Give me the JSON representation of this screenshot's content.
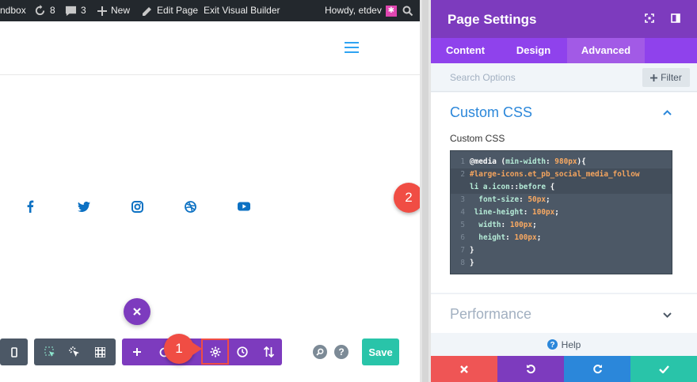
{
  "adminbar": {
    "site_label": "ndbox",
    "updates_count": "8",
    "comments_count": "3",
    "new_label": "New",
    "edit_label": "Edit Page",
    "exit_label": "Exit Visual Builder",
    "greeting": "Howdy, etdev"
  },
  "social_icons": [
    "facebook-icon",
    "twitter-icon",
    "instagram-icon",
    "dribbble-icon",
    "youtube-icon"
  ],
  "builder": {
    "save_label": "Save",
    "markers": {
      "one": "1",
      "two": "2"
    }
  },
  "panel": {
    "title": "Page Settings",
    "tabs": [
      {
        "label": "Content",
        "active": false
      },
      {
        "label": "Design",
        "active": false
      },
      {
        "label": "Advanced",
        "active": true
      }
    ],
    "search_placeholder": "Search Options",
    "filter_label": "Filter",
    "section_title": "Custom CSS",
    "field_label": "Custom CSS",
    "code_lines": [
      {
        "n": "1",
        "text": "@media (min-width: 980px){"
      },
      {
        "n": "2",
        "text": "#large-icons.et_pb_social_media_follow li a.icon::before {"
      },
      {
        "n": "3",
        "text": "font-size: 50px;"
      },
      {
        "n": "4",
        "text": "line-height: 100px;"
      },
      {
        "n": "5",
        "text": "width: 100px;"
      },
      {
        "n": "6",
        "text": "height: 100px;"
      },
      {
        "n": "7",
        "text": "}"
      },
      {
        "n": "8",
        "text": "}"
      }
    ],
    "performance_label": "Performance",
    "help_label": "Help"
  },
  "colors": {
    "purple": "#7d3bbe",
    "tab_purple": "#8f42ec",
    "blue": "#2b87da",
    "red": "#ef5555",
    "green": "#29c4a9",
    "marker": "#f04d44"
  }
}
